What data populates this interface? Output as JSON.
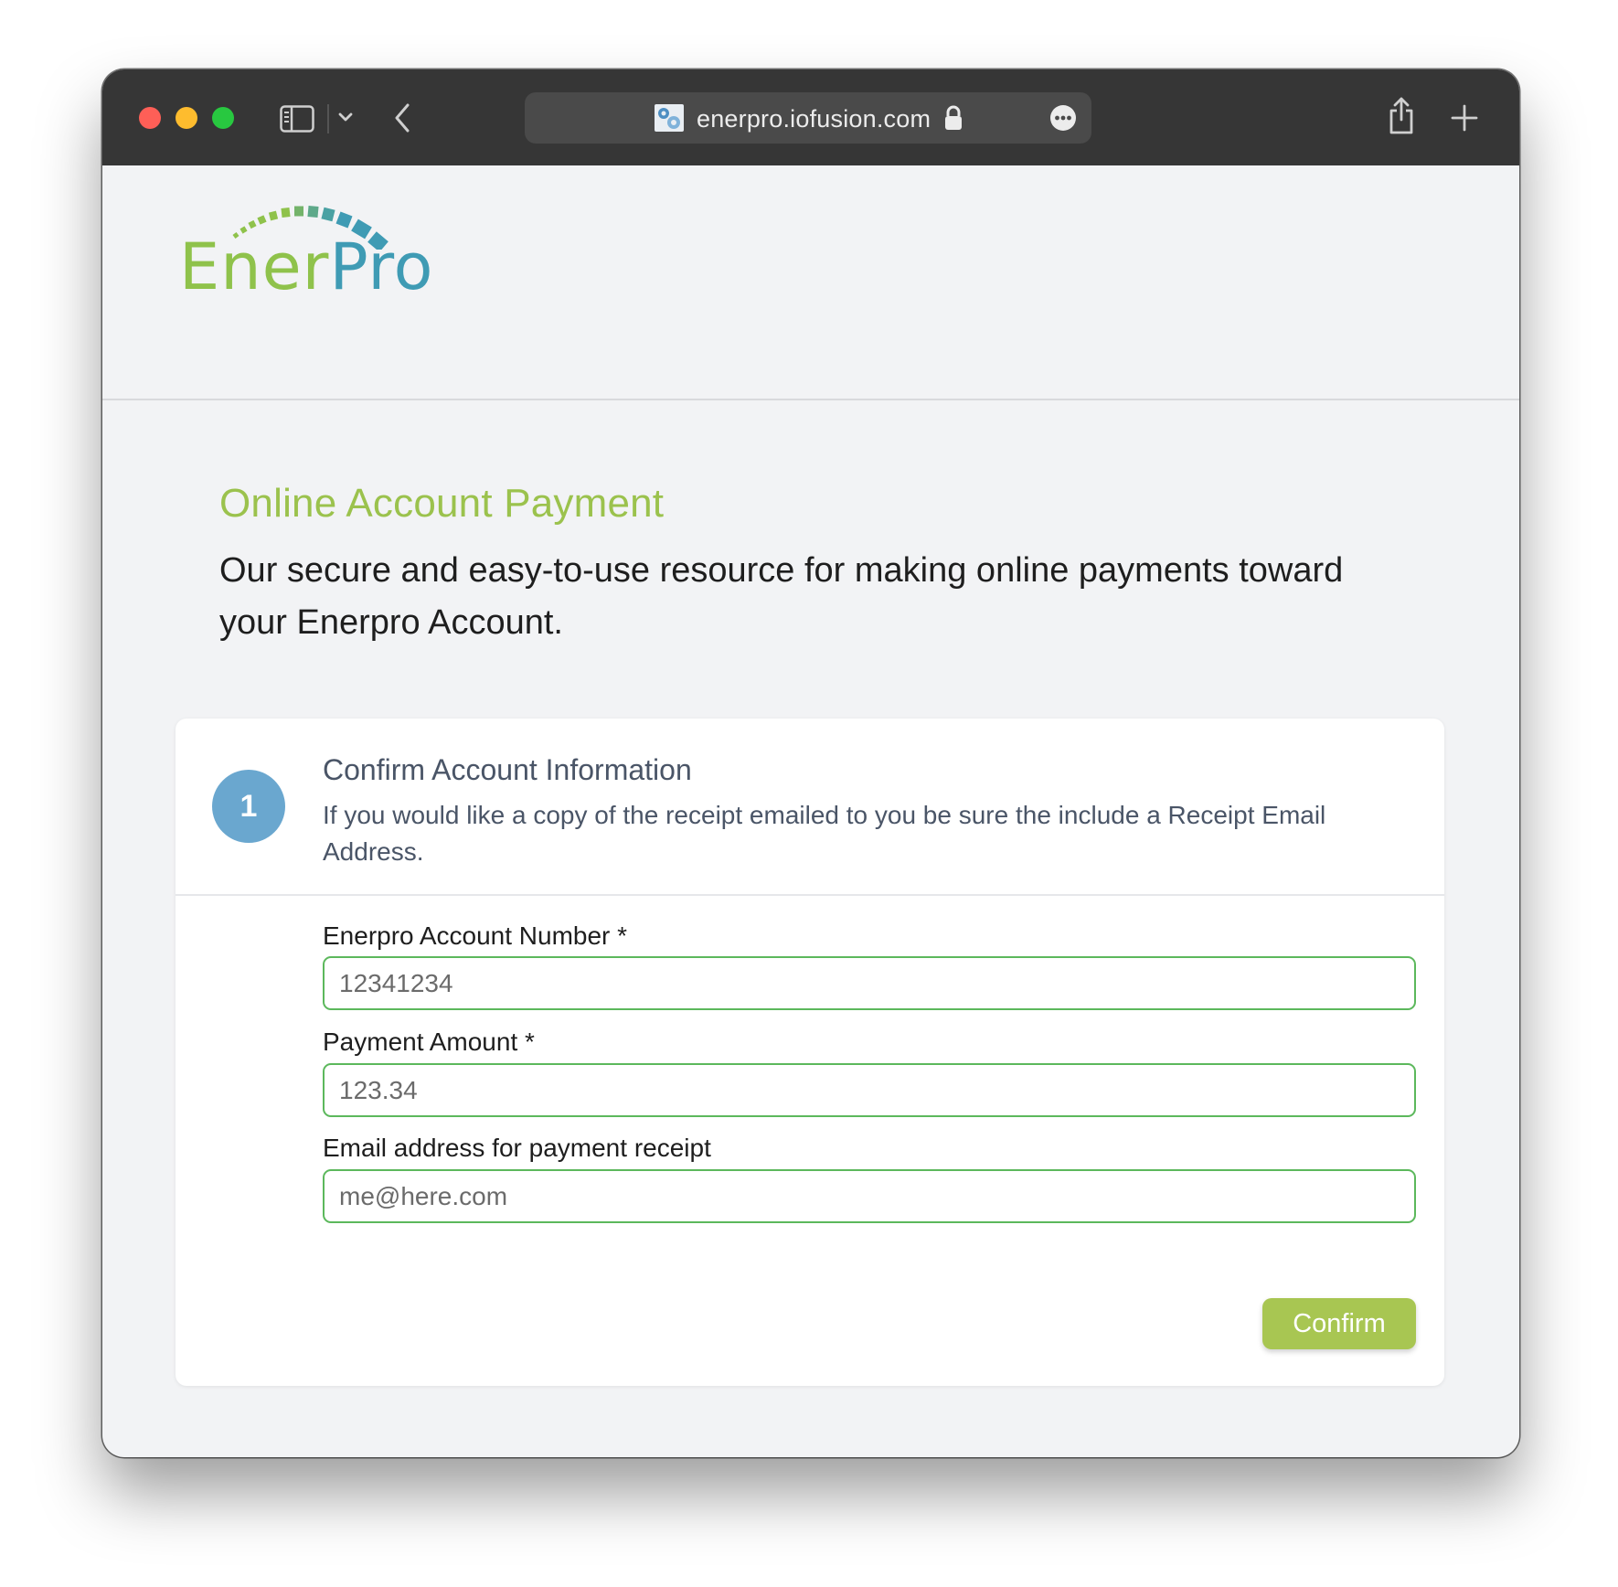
{
  "browser": {
    "url": "enerpro.iofusion.com",
    "icons": {
      "sidebar": "sidebar-icon",
      "dropdown": "chevron-down-icon",
      "back": "back-arrow-icon",
      "favicon": "site-favicon",
      "lock": "lock-icon",
      "more": "ellipsis-icon",
      "share": "share-icon",
      "new_tab": "plus-icon"
    }
  },
  "logo": {
    "part1": "Ener",
    "part2": "Pro",
    "colors": {
      "green": "#8fc24b",
      "teal": "#3f9bb4"
    }
  },
  "page": {
    "title": "Online Account Payment",
    "description": "Our secure and easy-to-use resource for making online payments toward your Enerpro Account."
  },
  "step": {
    "number": "1",
    "title": "Confirm Account Information",
    "description": "If you would like a copy of the receipt emailed to you be sure the include a Receipt Email Address."
  },
  "form": {
    "account_number": {
      "label": "Enerpro Account Number *",
      "placeholder": "12341234",
      "value": ""
    },
    "payment_amount": {
      "label": "Payment Amount *",
      "placeholder": "123.34",
      "value": ""
    },
    "email": {
      "label": "Email address for payment receipt",
      "placeholder": "me@here.com",
      "value": ""
    },
    "confirm_label": "Confirm"
  },
  "colors": {
    "accent_green": "#a8c652",
    "title_green": "#9bc24d",
    "input_border": "#5cb85c",
    "step_blue": "#6aa7cf",
    "toolbar": "#363636"
  }
}
